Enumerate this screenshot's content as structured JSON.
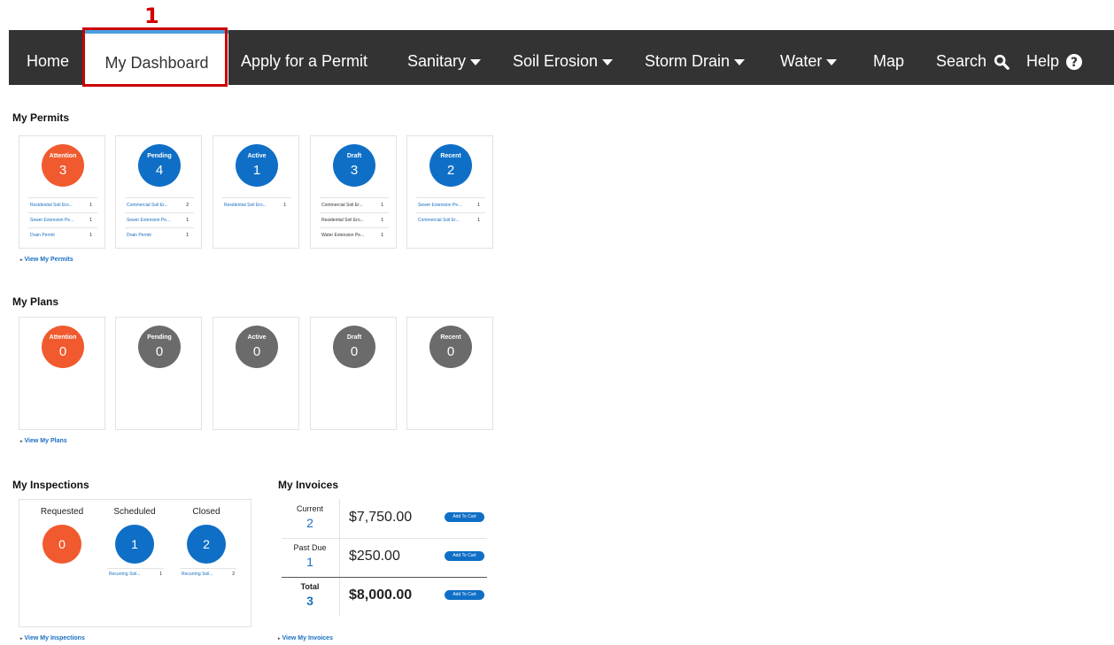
{
  "annotation": {
    "callout_number": "1"
  },
  "nav": {
    "home": "Home",
    "dashboard": "My Dashboard",
    "apply": "Apply for a Permit",
    "sanitary": "Sanitary",
    "soil": "Soil Erosion",
    "storm": "Storm Drain",
    "water": "Water",
    "map": "Map",
    "search": "Search",
    "help": "Help"
  },
  "permits": {
    "title": "My Permits",
    "view_link": "View My Permits",
    "cards": [
      {
        "label": "Attention",
        "count": "3",
        "rows": [
          {
            "t": "Residential Soil Ero...",
            "c": "1"
          },
          {
            "t": "Sewer Extension Pe...",
            "c": "1"
          },
          {
            "t": "Drain Permit",
            "c": "1"
          }
        ]
      },
      {
        "label": "Pending",
        "count": "4",
        "rows": [
          {
            "t": "Commercial Soil Er...",
            "c": "2"
          },
          {
            "t": "Sewer Extension Pe...",
            "c": "1"
          },
          {
            "t": "Drain Permit",
            "c": "1"
          }
        ]
      },
      {
        "label": "Active",
        "count": "1",
        "rows": [
          {
            "t": "Residential Soil Ero...",
            "c": "1"
          }
        ]
      },
      {
        "label": "Draft",
        "count": "3",
        "rows": [
          {
            "t": "Commercial Soil Er...",
            "c": "1"
          },
          {
            "t": "Residential Soil Ero...",
            "c": "1"
          },
          {
            "t": "Water Extension Pe...",
            "c": "1"
          }
        ]
      },
      {
        "label": "Recent",
        "count": "2",
        "rows": [
          {
            "t": "Sewer Extension Pe...",
            "c": "1"
          },
          {
            "t": "Commercial Soil Er...",
            "c": "1"
          }
        ]
      }
    ]
  },
  "plans": {
    "title": "My Plans",
    "view_link": "View My Plans",
    "cards": [
      {
        "label": "Attention",
        "count": "0"
      },
      {
        "label": "Pending",
        "count": "0"
      },
      {
        "label": "Active",
        "count": "0"
      },
      {
        "label": "Draft",
        "count": "0"
      },
      {
        "label": "Recent",
        "count": "0"
      }
    ]
  },
  "inspections": {
    "title": "My Inspections",
    "view_link": "View My Inspections",
    "columns": [
      {
        "label": "Requested",
        "count": "0"
      },
      {
        "label": "Scheduled",
        "count": "1",
        "row": {
          "t": "Recurring Soil...",
          "c": "1"
        }
      },
      {
        "label": "Closed",
        "count": "2",
        "row": {
          "t": "Recurring Soil...",
          "c": "2"
        }
      }
    ]
  },
  "invoices": {
    "title": "My Invoices",
    "view_link": "View My Invoices",
    "rows": [
      {
        "label": "Current",
        "count": "2",
        "amount": "$7,750.00",
        "button": "Add To Cart"
      },
      {
        "label": "Past Due",
        "count": "1",
        "amount": "$250.00",
        "button": "Add To Cart"
      },
      {
        "label": "Total",
        "count": "3",
        "amount": "$8,000.00",
        "button": "Add To Cart"
      }
    ]
  },
  "colors": {
    "nav_bg": "#333333",
    "attention": "#f05a2e",
    "primary": "#0f6fc6",
    "inactive": "#6b6b6b",
    "callout": "#cc0000"
  }
}
